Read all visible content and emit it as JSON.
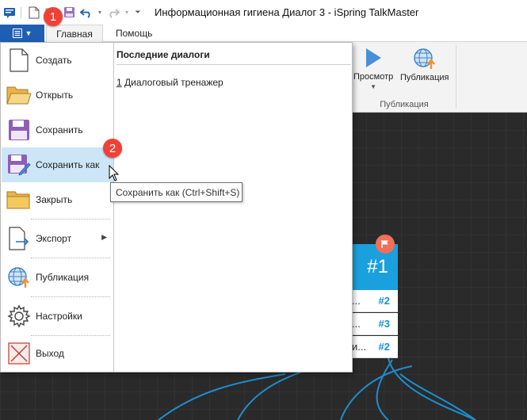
{
  "window": {
    "title": "Информационная гигиена Диалог 3 - iSpring TalkMaster"
  },
  "tabs": {
    "home": "Главная",
    "help": "Помощь"
  },
  "ribbon": {
    "preview_label": "Просмотр",
    "publish_label": "Публикация",
    "group_label": "Публикация"
  },
  "file_menu": {
    "items": [
      {
        "label": "Создать",
        "icon": "new-file-icon"
      },
      {
        "label": "Открыть",
        "icon": "folder-open-icon"
      },
      {
        "label": "Сохранить",
        "icon": "save-icon"
      },
      {
        "label": "Сохранить как",
        "icon": "save-as-icon",
        "active": true
      },
      {
        "label": "Закрыть",
        "icon": "folder-close-icon"
      },
      {
        "label": "Экспорт",
        "icon": "export-icon",
        "submenu": true
      },
      {
        "label": "Публикация",
        "icon": "globe-publish-icon"
      },
      {
        "label": "Настройки",
        "icon": "gear-icon"
      },
      {
        "label": "Выход",
        "icon": "exit-icon"
      }
    ],
    "recent_title": "Последние диалоги",
    "recent_item": {
      "index": "1",
      "label": "Диалоговый тренажер"
    }
  },
  "tooltip": {
    "text": "Сохранить как (Ctrl+Shift+S)"
  },
  "badges": {
    "first": "1",
    "second": "2"
  },
  "node": {
    "id": "#1",
    "rows": [
      {
        "text": "...",
        "ref": "#2"
      },
      {
        "text": "...",
        "ref": "#3"
      },
      {
        "text": "и...",
        "ref": "#2"
      }
    ]
  },
  "colors": {
    "accent": "#1f5fb3",
    "node": "#1aa0dc",
    "badge": "#ef4136",
    "active_item": "#cde6f7"
  }
}
